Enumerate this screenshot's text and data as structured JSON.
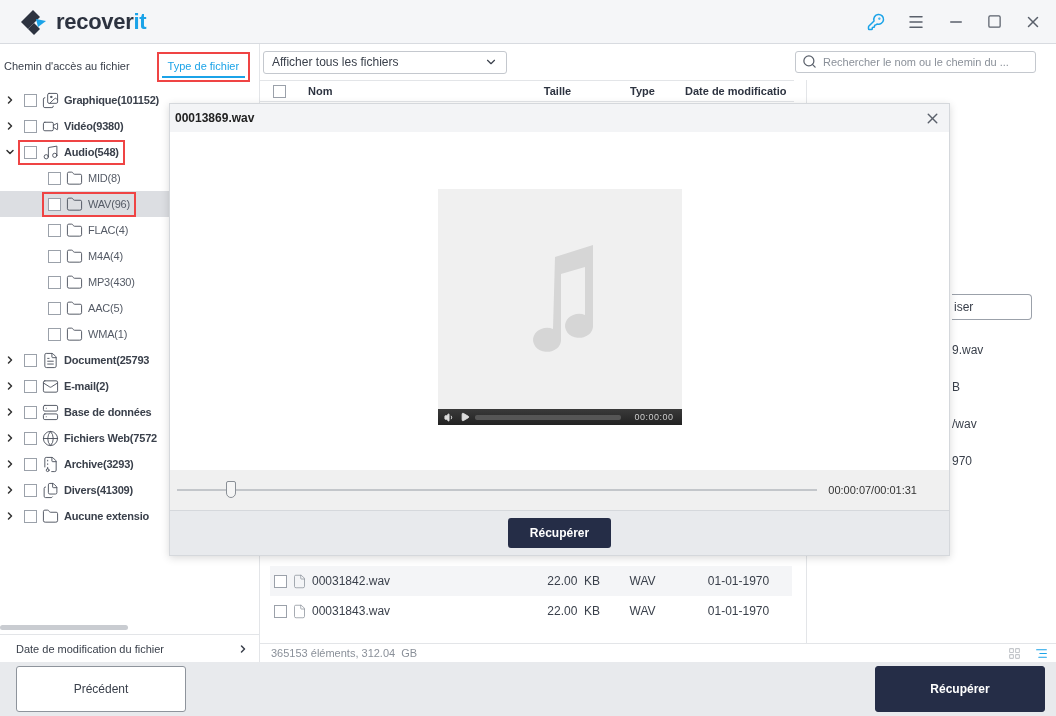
{
  "header": {
    "logo": {
      "text": "recover",
      "accent": "it"
    }
  },
  "sidebar": {
    "tabs": [
      {
        "label": "Chemin d'accès au fichier",
        "selected": false,
        "annotated": false
      },
      {
        "label": "Type de fichier",
        "selected": true,
        "annotated": true
      }
    ],
    "tree": [
      {
        "label": "Graphique(101152)",
        "expanded": false,
        "checked": false,
        "selected": false,
        "annotated": false
      },
      {
        "label": "Vidéo(9380)",
        "expanded": false,
        "checked": false,
        "selected": false,
        "annotated": false
      },
      {
        "label": "Audio(548)",
        "expanded": true,
        "checked": false,
        "selected": false,
        "annotated": true,
        "children": [
          {
            "label": "MID(8)",
            "checked": false,
            "selected": false,
            "annotated": false
          },
          {
            "label": "WAV(96)",
            "checked": false,
            "selected": true,
            "annotated": true
          },
          {
            "label": "FLAC(4)",
            "checked": false,
            "selected": false,
            "annotated": false
          },
          {
            "label": "M4A(4)",
            "checked": false,
            "selected": false,
            "annotated": false
          },
          {
            "label": "MP3(430)",
            "checked": false,
            "selected": false,
            "annotated": false
          },
          {
            "label": "AAC(5)",
            "checked": false,
            "selected": false,
            "annotated": false
          },
          {
            "label": "WMA(1)",
            "checked": false,
            "selected": false,
            "annotated": false
          }
        ]
      },
      {
        "label": "Document(25793",
        "expanded": false,
        "checked": false,
        "selected": false,
        "annotated": false
      },
      {
        "label": "E-mail(2)",
        "expanded": false,
        "checked": false,
        "selected": false,
        "annotated": false
      },
      {
        "label": "Base de données",
        "expanded": false,
        "checked": false,
        "selected": false,
        "annotated": false
      },
      {
        "label": "Fichiers Web(7572",
        "expanded": false,
        "checked": false,
        "selected": false,
        "annotated": false
      },
      {
        "label": "Archive(3293)",
        "expanded": false,
        "checked": false,
        "selected": false,
        "annotated": false
      },
      {
        "label": "Divers(41309)",
        "expanded": false,
        "checked": false,
        "selected": false,
        "annotated": false
      },
      {
        "label": "Aucune extensio",
        "expanded": false,
        "checked": false,
        "selected": false,
        "annotated": false
      }
    ],
    "filter_section": "Date de modification du fichier"
  },
  "toolbar": {
    "filter": "Afficher tous les fichiers",
    "search": {
      "placeholder": "Rechercher le nom ou le chemin du ..."
    }
  },
  "table": {
    "columns": [
      "Nom",
      "Taille",
      "Type",
      "Date de modificatio"
    ],
    "header_checked": false,
    "rows": [
      {
        "name": "00031842.wav",
        "size": "22.00  KB",
        "type": "WAV",
        "date": "01-01-1970",
        "checked": false
      },
      {
        "name": "00031843.wav",
        "size": "22.00  KB",
        "type": "WAV",
        "date": "01-01-1970",
        "checked": false
      }
    ]
  },
  "details": {
    "button": "iser",
    "values": [
      "9.wav",
      "B",
      "/wav",
      "970"
    ]
  },
  "status_bar": "365153 éléments, 312.04  GB",
  "preview": {
    "title": "00013869.wav",
    "player_time": "00:00:00",
    "position": {
      "level": 0.085
    },
    "time": "00:00:07/00:01:31",
    "recover": "Récupérer"
  },
  "footer": {
    "back": "Précédent",
    "recover": "Récupérer"
  }
}
